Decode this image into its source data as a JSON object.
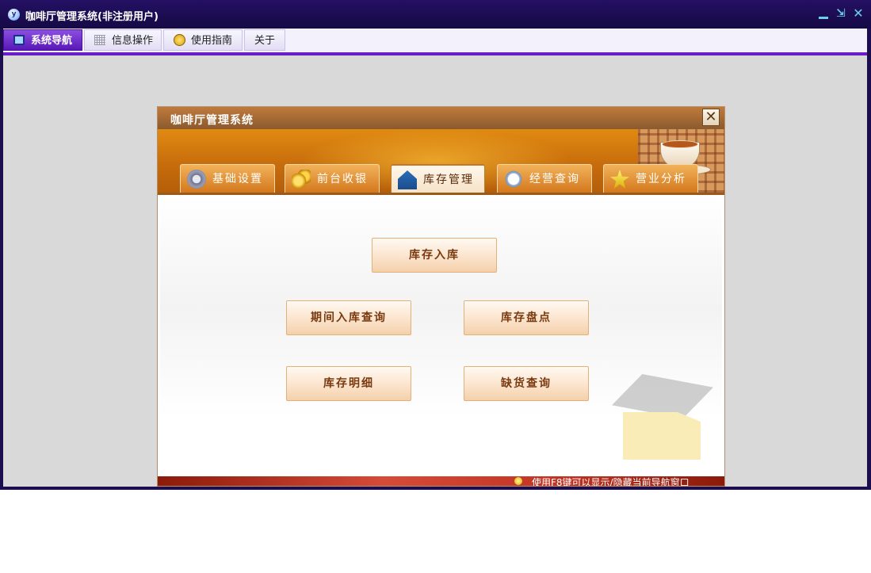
{
  "window": {
    "title": "咖啡厅管理系统(非注册用户)",
    "logo_glyph": "y"
  },
  "window_controls": {
    "minimize": "",
    "restore": "⇲",
    "close": "✕"
  },
  "menu": [
    {
      "label": "系统导航",
      "active": true
    },
    {
      "label": "信息操作",
      "active": false
    },
    {
      "label": "使用指南",
      "active": false
    },
    {
      "label": "关于",
      "active": false
    }
  ],
  "dialog": {
    "title": "咖啡厅管理系统",
    "close_glyph": "✕",
    "tabs": [
      {
        "label": "基础设置",
        "icon": "gear-icon"
      },
      {
        "label": "前台收银",
        "icon": "coins-icon"
      },
      {
        "label": "库存管理",
        "icon": "house-icon",
        "active": true
      },
      {
        "label": "经营查询",
        "icon": "magnifier-icon"
      },
      {
        "label": "营业分析",
        "icon": "star-icon"
      }
    ],
    "buttons": {
      "stock_in": "库存入库",
      "period_query": "期间入库查询",
      "stocktake": "库存盘点",
      "stock_detail": "库存明细",
      "shortage": "缺货查询"
    },
    "status_text": "使用F8键可以显示/隐藏当前导航窗口"
  },
  "colors": {
    "window_frame": "#1c0d4e",
    "menu_accent": "#6a1cc6",
    "banner": "#d87a10",
    "button_text": "#7a3a10",
    "status_bar": "#c23424"
  }
}
